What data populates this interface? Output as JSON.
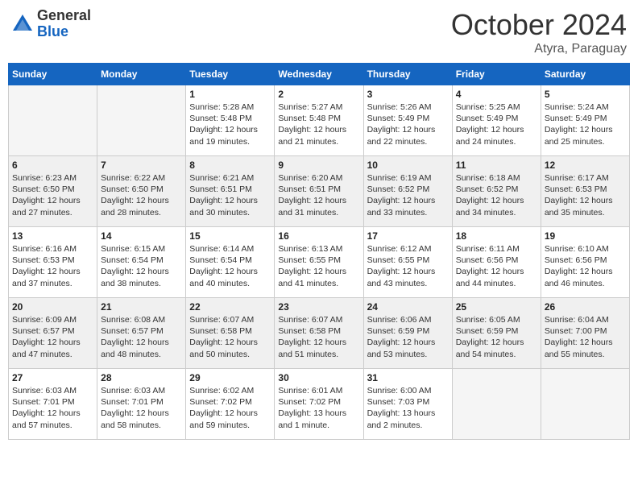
{
  "header": {
    "logo_general": "General",
    "logo_blue": "Blue",
    "month_title": "October 2024",
    "subtitle": "Atyra, Paraguay"
  },
  "calendar": {
    "days_of_week": [
      "Sunday",
      "Monday",
      "Tuesday",
      "Wednesday",
      "Thursday",
      "Friday",
      "Saturday"
    ],
    "weeks": [
      [
        {
          "day": "",
          "info": ""
        },
        {
          "day": "",
          "info": ""
        },
        {
          "day": "1",
          "info": "Sunrise: 5:28 AM\nSunset: 5:48 PM\nDaylight: 12 hours and 19 minutes."
        },
        {
          "day": "2",
          "info": "Sunrise: 5:27 AM\nSunset: 5:48 PM\nDaylight: 12 hours and 21 minutes."
        },
        {
          "day": "3",
          "info": "Sunrise: 5:26 AM\nSunset: 5:49 PM\nDaylight: 12 hours and 22 minutes."
        },
        {
          "day": "4",
          "info": "Sunrise: 5:25 AM\nSunset: 5:49 PM\nDaylight: 12 hours and 24 minutes."
        },
        {
          "day": "5",
          "info": "Sunrise: 5:24 AM\nSunset: 5:49 PM\nDaylight: 12 hours and 25 minutes."
        }
      ],
      [
        {
          "day": "6",
          "info": "Sunrise: 6:23 AM\nSunset: 6:50 PM\nDaylight: 12 hours and 27 minutes."
        },
        {
          "day": "7",
          "info": "Sunrise: 6:22 AM\nSunset: 6:50 PM\nDaylight: 12 hours and 28 minutes."
        },
        {
          "day": "8",
          "info": "Sunrise: 6:21 AM\nSunset: 6:51 PM\nDaylight: 12 hours and 30 minutes."
        },
        {
          "day": "9",
          "info": "Sunrise: 6:20 AM\nSunset: 6:51 PM\nDaylight: 12 hours and 31 minutes."
        },
        {
          "day": "10",
          "info": "Sunrise: 6:19 AM\nSunset: 6:52 PM\nDaylight: 12 hours and 33 minutes."
        },
        {
          "day": "11",
          "info": "Sunrise: 6:18 AM\nSunset: 6:52 PM\nDaylight: 12 hours and 34 minutes."
        },
        {
          "day": "12",
          "info": "Sunrise: 6:17 AM\nSunset: 6:53 PM\nDaylight: 12 hours and 35 minutes."
        }
      ],
      [
        {
          "day": "13",
          "info": "Sunrise: 6:16 AM\nSunset: 6:53 PM\nDaylight: 12 hours and 37 minutes."
        },
        {
          "day": "14",
          "info": "Sunrise: 6:15 AM\nSunset: 6:54 PM\nDaylight: 12 hours and 38 minutes."
        },
        {
          "day": "15",
          "info": "Sunrise: 6:14 AM\nSunset: 6:54 PM\nDaylight: 12 hours and 40 minutes."
        },
        {
          "day": "16",
          "info": "Sunrise: 6:13 AM\nSunset: 6:55 PM\nDaylight: 12 hours and 41 minutes."
        },
        {
          "day": "17",
          "info": "Sunrise: 6:12 AM\nSunset: 6:55 PM\nDaylight: 12 hours and 43 minutes."
        },
        {
          "day": "18",
          "info": "Sunrise: 6:11 AM\nSunset: 6:56 PM\nDaylight: 12 hours and 44 minutes."
        },
        {
          "day": "19",
          "info": "Sunrise: 6:10 AM\nSunset: 6:56 PM\nDaylight: 12 hours and 46 minutes."
        }
      ],
      [
        {
          "day": "20",
          "info": "Sunrise: 6:09 AM\nSunset: 6:57 PM\nDaylight: 12 hours and 47 minutes."
        },
        {
          "day": "21",
          "info": "Sunrise: 6:08 AM\nSunset: 6:57 PM\nDaylight: 12 hours and 48 minutes."
        },
        {
          "day": "22",
          "info": "Sunrise: 6:07 AM\nSunset: 6:58 PM\nDaylight: 12 hours and 50 minutes."
        },
        {
          "day": "23",
          "info": "Sunrise: 6:07 AM\nSunset: 6:58 PM\nDaylight: 12 hours and 51 minutes."
        },
        {
          "day": "24",
          "info": "Sunrise: 6:06 AM\nSunset: 6:59 PM\nDaylight: 12 hours and 53 minutes."
        },
        {
          "day": "25",
          "info": "Sunrise: 6:05 AM\nSunset: 6:59 PM\nDaylight: 12 hours and 54 minutes."
        },
        {
          "day": "26",
          "info": "Sunrise: 6:04 AM\nSunset: 7:00 PM\nDaylight: 12 hours and 55 minutes."
        }
      ],
      [
        {
          "day": "27",
          "info": "Sunrise: 6:03 AM\nSunset: 7:01 PM\nDaylight: 12 hours and 57 minutes."
        },
        {
          "day": "28",
          "info": "Sunrise: 6:03 AM\nSunset: 7:01 PM\nDaylight: 12 hours and 58 minutes."
        },
        {
          "day": "29",
          "info": "Sunrise: 6:02 AM\nSunset: 7:02 PM\nDaylight: 12 hours and 59 minutes."
        },
        {
          "day": "30",
          "info": "Sunrise: 6:01 AM\nSunset: 7:02 PM\nDaylight: 13 hours and 1 minute."
        },
        {
          "day": "31",
          "info": "Sunrise: 6:00 AM\nSunset: 7:03 PM\nDaylight: 13 hours and 2 minutes."
        },
        {
          "day": "",
          "info": ""
        },
        {
          "day": "",
          "info": ""
        }
      ]
    ]
  }
}
